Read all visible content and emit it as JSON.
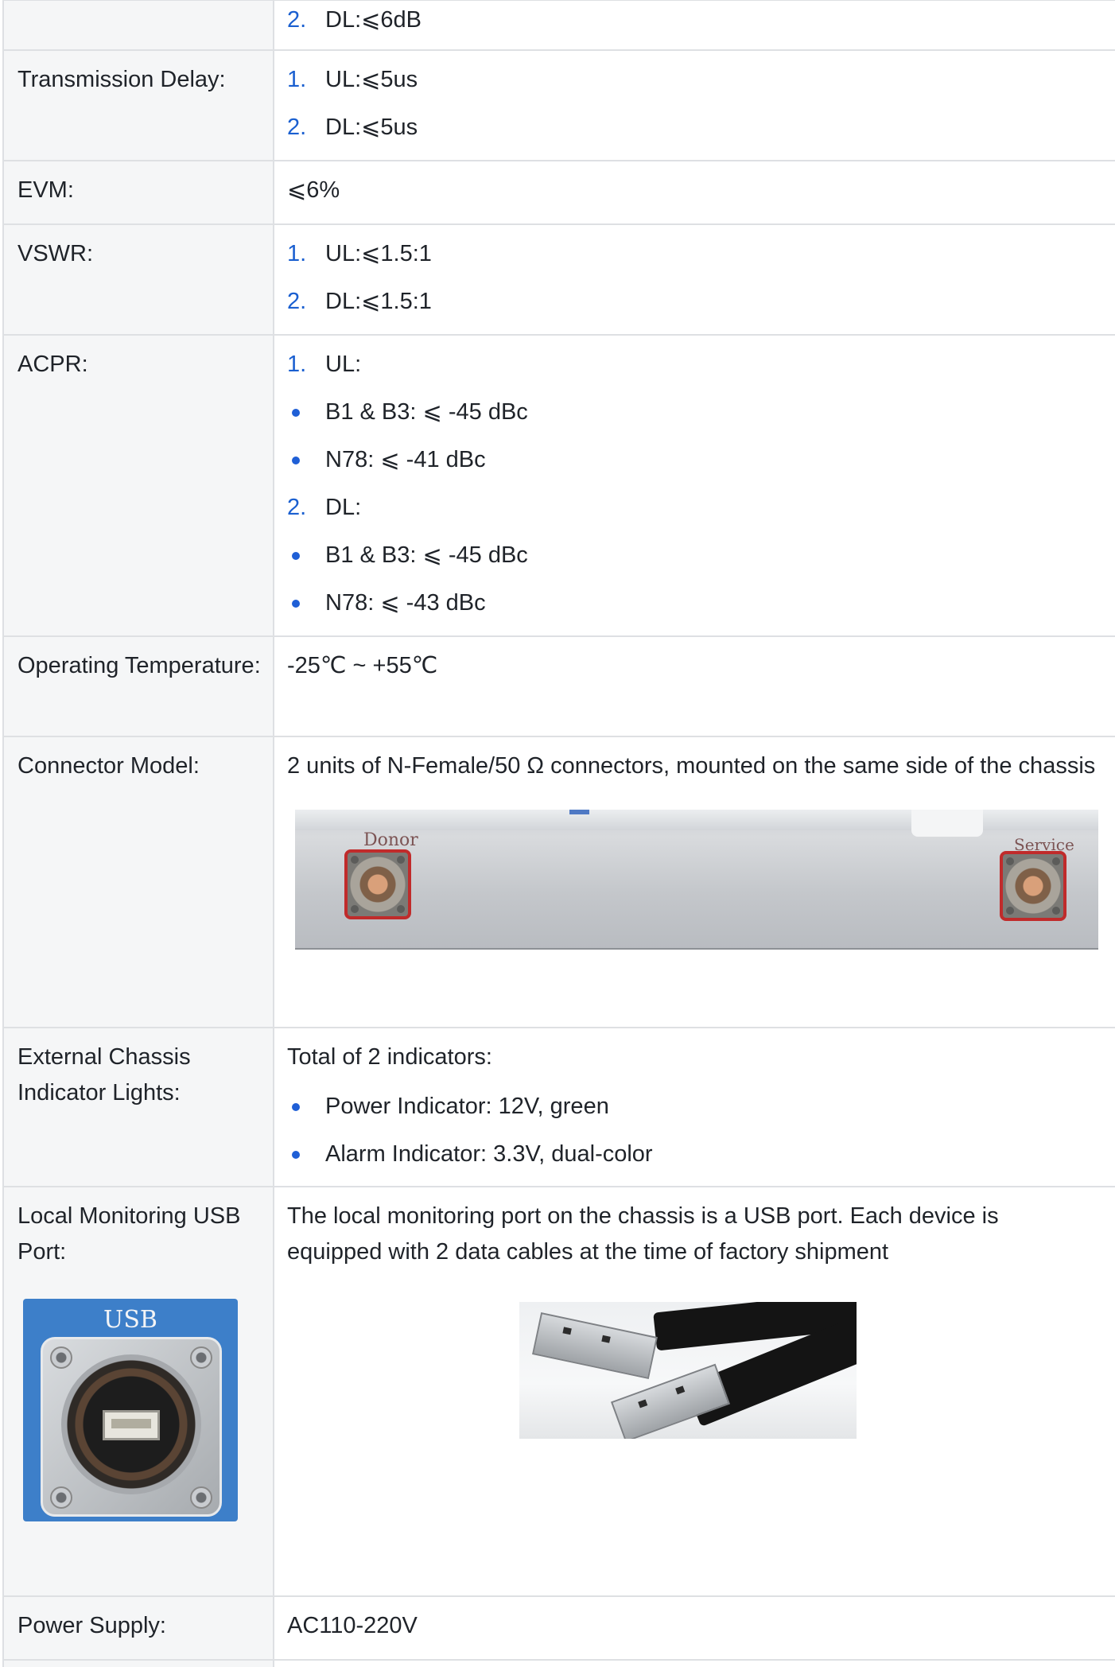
{
  "rows": [
    {
      "id": "fragment-top",
      "items": [
        {
          "marker": "2.",
          "text": "DL:⩽6dB"
        }
      ]
    },
    {
      "id": "transmission-delay",
      "label": "Transmission Delay:",
      "items": [
        {
          "marker": "1.",
          "text": "UL:⩽5us"
        },
        {
          "marker": "2.",
          "text": "DL:⩽5us"
        }
      ]
    },
    {
      "id": "evm",
      "label": "EVM:",
      "value": "⩽6%"
    },
    {
      "id": "vswr",
      "label": "VSWR:",
      "items": [
        {
          "marker": "1.",
          "text": "UL:⩽1.5:1"
        },
        {
          "marker": "2.",
          "text": "DL:⩽1.5:1"
        }
      ]
    },
    {
      "id": "acpr",
      "label": "ACPR:",
      "items": [
        {
          "marker": "1.",
          "text": "UL:"
        },
        {
          "bullet": true,
          "text": "B1 & B3: ⩽ -45 dBc"
        },
        {
          "bullet": true,
          "text": "N78: ⩽ -41 dBc"
        },
        {
          "marker": "2.",
          "text": "DL:"
        },
        {
          "bullet": true,
          "text": "B1 & B3: ⩽ -45 dBc"
        },
        {
          "bullet": true,
          "text": "N78: ⩽ -43 dBc"
        }
      ]
    },
    {
      "id": "operating-temperature",
      "label": "Operating Temperature:",
      "value": "-25℃ ~ +55℃"
    },
    {
      "id": "connector-model",
      "label": "Connector Model:",
      "value": "2 units of N-Female/50 Ω connectors, mounted on the same side of the chassis",
      "image_labels": {
        "left": "Donor",
        "right": "Service"
      }
    },
    {
      "id": "external-indicators",
      "label": "External Chassis Indicator Lights:",
      "value": "Total of 2 indicators:",
      "items": [
        {
          "bullet": true,
          "text": "Power Indicator: 12V, green"
        },
        {
          "bullet": true,
          "text": "Alarm Indicator: 3.3V, dual-color"
        }
      ]
    },
    {
      "id": "usb-port",
      "label": "Local Monitoring USB Port:",
      "value": "The local monitoring port on the chassis is a USB port. Each device is equipped with 2 data cables at the time of factory shipment",
      "image_text": "USB"
    },
    {
      "id": "power-supply",
      "label": "Power Supply:",
      "value": "AC110-220V"
    }
  ],
  "colors": {
    "border": "#dee0e3",
    "label_bg": "#f5f6f7",
    "marker": "#1a5fd0",
    "text": "#1f2329"
  }
}
